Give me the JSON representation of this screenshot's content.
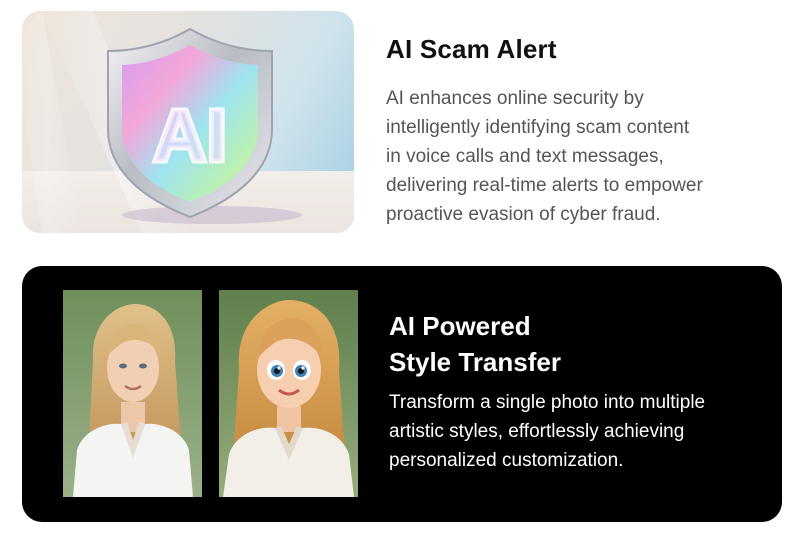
{
  "scam_alert": {
    "title": "AI Scam Alert",
    "shield_text": "AI",
    "description_lines": [
      "AI enhances online security by",
      "intelligently identifying scam content",
      "in voice calls and text messages,",
      "delivering real-time alerts to empower",
      "proactive evasion of cyber fraud."
    ]
  },
  "style_transfer": {
    "title_lines": [
      "AI Powered",
      "Style Transfer"
    ],
    "description_lines": [
      "Transform a single photo into multiple",
      "artistic styles, effortlessly achieving",
      "personalized customization."
    ]
  },
  "colors": {
    "page_background": "#ffffff",
    "dark_card_background": "#000000",
    "title_dark": "#111111",
    "body_gray": "#555555",
    "text_on_dark": "#ffffff"
  }
}
